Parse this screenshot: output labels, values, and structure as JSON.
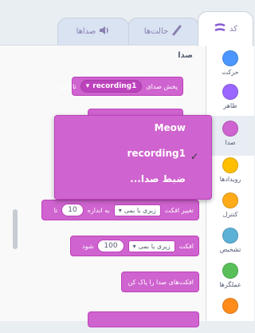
{
  "tabs": [
    {
      "label": "کد",
      "icon": "code-icon"
    },
    {
      "label": "حالت‌ها",
      "icon": "brush-icon"
    },
    {
      "label": "صداها",
      "icon": "speaker-icon"
    }
  ],
  "section_title": "صدا",
  "categories": [
    {
      "label": "حرکت",
      "color": "#4c97ff"
    },
    {
      "label": "ظاهر",
      "color": "#9966ff"
    },
    {
      "label": "صدا",
      "color": "#cf63cf"
    },
    {
      "label": "رویدادها",
      "color": "#ffbf00"
    },
    {
      "label": "کنترل",
      "color": "#ffab19"
    },
    {
      "label": "تشخیص",
      "color": "#5cb1d6"
    },
    {
      "label": "عملگرها",
      "color": "#59c059"
    },
    {
      "label": "",
      "color": "#ff8c1a"
    }
  ],
  "blocks": {
    "play_until_done": {
      "text_prefix": "پخش صدای",
      "sound": "recording1",
      "text_suffix": "تا انتها"
    },
    "set_effect": {
      "prefix": "تغییر افکت",
      "effect": "زیری یا بمی",
      "by": "به اندازه",
      "value": "10",
      "suffix": "تا"
    },
    "set_effect_to": {
      "prefix": "افکت",
      "effect": "زیری یا بمی",
      "value": "100",
      "suffix": "شود"
    },
    "clear_effects": {
      "text": "افکت‌های صدا را پاک کن"
    }
  },
  "menu": {
    "items": [
      "Meow",
      "recording1",
      "ضبط صدا..."
    ],
    "selected": "recording1",
    "check": "✓"
  }
}
